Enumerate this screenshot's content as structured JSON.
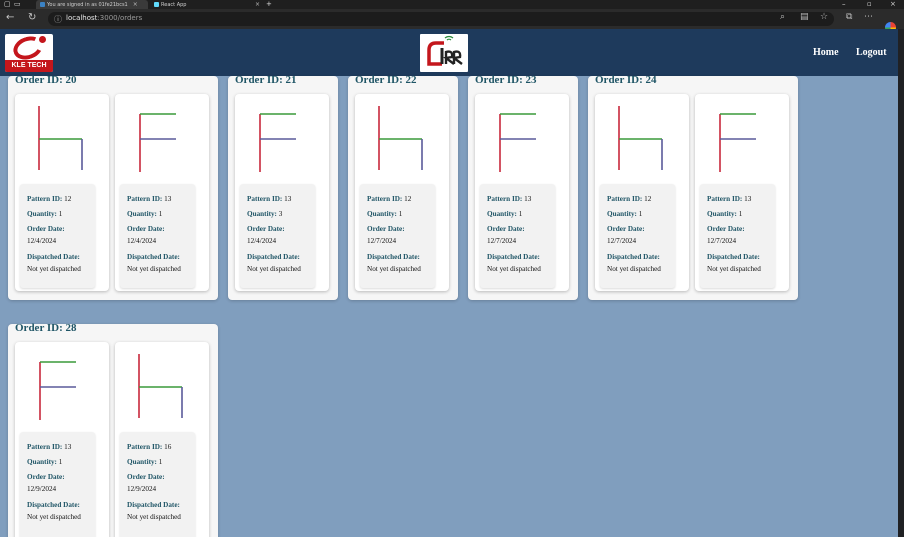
{
  "browser": {
    "tabs": [
      {
        "label": "You are signed in as 01fe21bcs1"
      },
      {
        "label": "React App"
      }
    ],
    "url_host": "localhost",
    "url_rest": ":3000/orders"
  },
  "navbar": {
    "left_logo_text": "KLE TECH",
    "nav_items": [
      {
        "label": "Home"
      },
      {
        "label": "Logout"
      }
    ]
  },
  "colors": {
    "navbar": "#1e3a5c",
    "background": "#809ebe",
    "heading": "#1f5566",
    "line_red": "#c8283c",
    "line_green": "#3a9a3a",
    "line_purple": "#5a5a9a"
  },
  "labels": {
    "order_id": "Order ID:",
    "pattern_id": "Pattern ID:",
    "quantity": "Quantity:",
    "order_date": "Order Date:",
    "dispatched_date": "Dispatched Date:"
  },
  "orders": [
    {
      "id": "20",
      "items": [
        {
          "shape": "h",
          "pattern_id": "12",
          "quantity": "1",
          "order_date": "12/4/2024",
          "dispatched": "Not yet dispatched"
        },
        {
          "shape": "f",
          "pattern_id": "13",
          "quantity": "1",
          "order_date": "12/4/2024",
          "dispatched": "Not yet dispatched"
        }
      ]
    },
    {
      "id": "21",
      "items": [
        {
          "shape": "f",
          "pattern_id": "13",
          "quantity": "3",
          "order_date": "12/4/2024",
          "dispatched": "Not yet dispatched"
        }
      ]
    },
    {
      "id": "22",
      "items": [
        {
          "shape": "h",
          "pattern_id": "12",
          "quantity": "1",
          "order_date": "12/7/2024",
          "dispatched": "Not yet dispatched"
        }
      ]
    },
    {
      "id": "23",
      "items": [
        {
          "shape": "f",
          "pattern_id": "13",
          "quantity": "1",
          "order_date": "12/7/2024",
          "dispatched": "Not yet dispatched"
        }
      ]
    },
    {
      "id": "24",
      "items": [
        {
          "shape": "h",
          "pattern_id": "12",
          "quantity": "1",
          "order_date": "12/7/2024",
          "dispatched": "Not yet dispatched"
        },
        {
          "shape": "f",
          "pattern_id": "13",
          "quantity": "1",
          "order_date": "12/7/2024",
          "dispatched": "Not yet dispatched"
        }
      ]
    },
    {
      "id": "28",
      "items": [
        {
          "shape": "f",
          "pattern_id": "13",
          "quantity": "1",
          "order_date": "12/9/2024",
          "dispatched": "Not yet dispatched"
        },
        {
          "shape": "h",
          "pattern_id": "16",
          "quantity": "1",
          "order_date": "12/9/2024",
          "dispatched": "Not yet dispatched"
        }
      ]
    }
  ]
}
